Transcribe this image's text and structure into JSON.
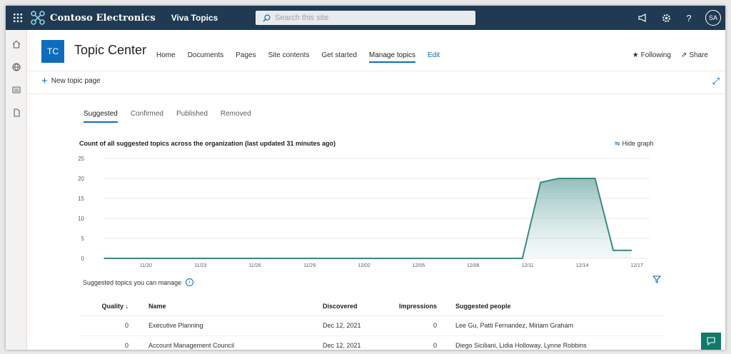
{
  "suite_bar": {
    "brand_name": "Contoso Electronics",
    "app_name": "Viva Topics",
    "search_placeholder": "Search this site",
    "avatar_initials": "SA"
  },
  "site": {
    "logo_text": "TC",
    "title": "Topic Center",
    "nav": [
      {
        "label": "Home"
      },
      {
        "label": "Documents"
      },
      {
        "label": "Pages"
      },
      {
        "label": "Site contents"
      },
      {
        "label": "Get started"
      },
      {
        "label": "Manage topics"
      },
      {
        "label": "Edit"
      }
    ],
    "following_label": "Following",
    "share_label": "Share"
  },
  "command_bar": {
    "new_topic_label": "New topic page"
  },
  "tabs": [
    {
      "label": "Suggested"
    },
    {
      "label": "Confirmed"
    },
    {
      "label": "Published"
    },
    {
      "label": "Removed"
    }
  ],
  "chart_header": {
    "title": "Count of all suggested topics across the organization (last updated 31 minutes ago)",
    "hide_graph_label": "Hide graph"
  },
  "chart_data": {
    "type": "area",
    "title": "Count of all suggested topics across the organization (last updated 31 minutes ago)",
    "xlabel": "",
    "ylabel": "",
    "ylim": [
      0,
      25
    ],
    "yticks": [
      "0",
      "5",
      "10",
      "15",
      "20",
      "25"
    ],
    "xticks": [
      "11/20",
      "11/23",
      "11/26",
      "11/29",
      "12/02",
      "12/05",
      "12/08",
      "12/11",
      "12/14",
      "12/17"
    ],
    "xlim": [
      0,
      30
    ],
    "points": [
      {
        "x": 0,
        "y": 0
      },
      {
        "x": 23,
        "y": 0
      },
      {
        "x": 24,
        "y": 19
      },
      {
        "x": 25,
        "y": 20
      },
      {
        "x": 27,
        "y": 20
      },
      {
        "x": 28,
        "y": 2
      },
      {
        "x": 29,
        "y": 2
      }
    ],
    "grid": true,
    "color": "#3a8a84",
    "fill_color": "#d3ebe7"
  },
  "section": {
    "title": "Suggested topics you can manage"
  },
  "table": {
    "headers": {
      "quality": "Quality ↓",
      "name": "Name",
      "discovered": "Discovered",
      "impressions": "Impressions",
      "people": "Suggested people"
    },
    "rows": [
      {
        "quality": "0",
        "name": "Executive Planning",
        "discovered": "Dec 12, 2021",
        "impressions": "0",
        "people": "Lee Gu, Patti Fernandez, Miriam Graham"
      },
      {
        "quality": "0",
        "name": "Account Management Council",
        "discovered": "Dec 12, 2021",
        "impressions": "0",
        "people": "Diego Siciliani, Lidia Holloway, Lynne Robbins"
      }
    ]
  }
}
